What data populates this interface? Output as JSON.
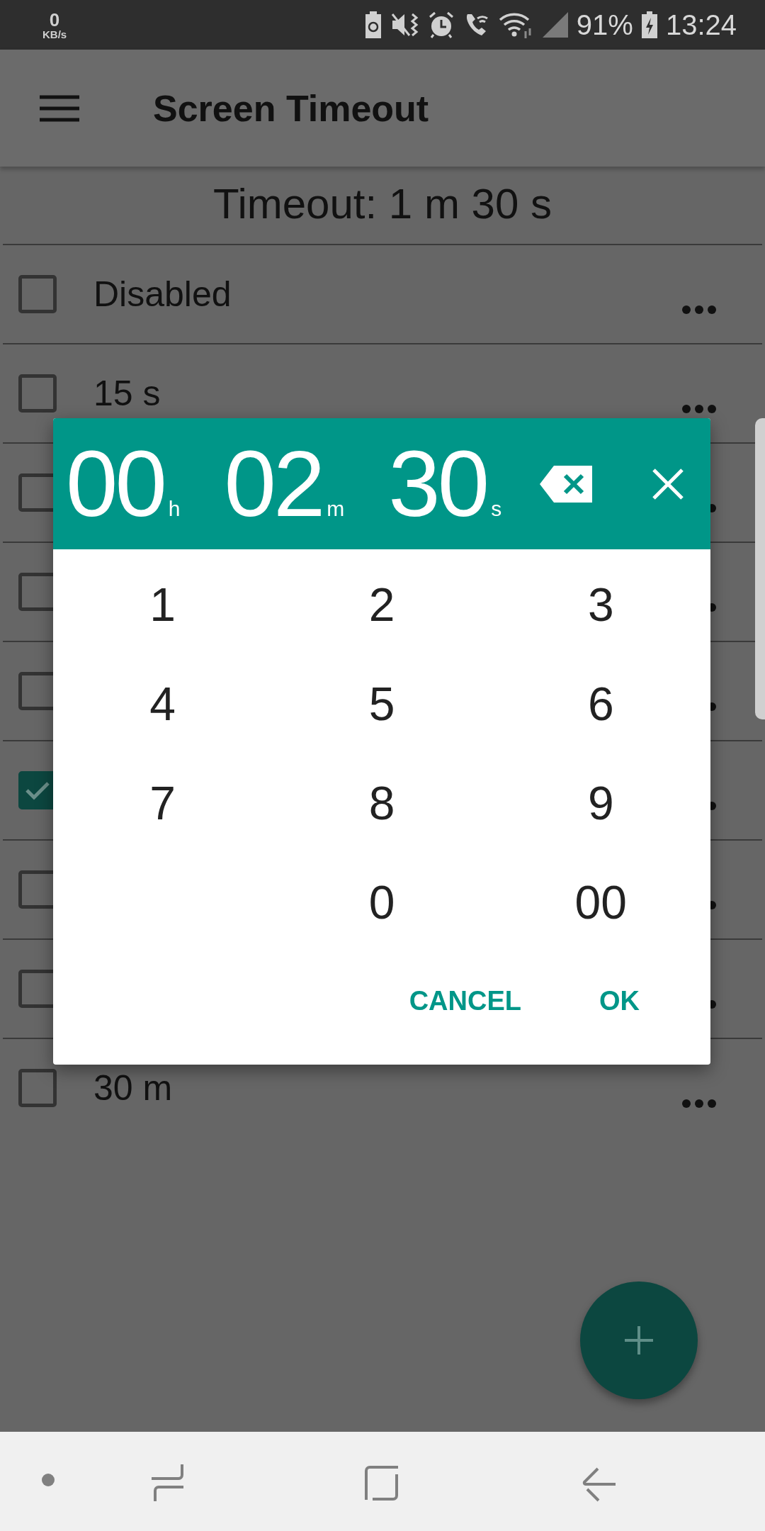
{
  "status_bar": {
    "net_speed": "0",
    "net_unit": "KB/s",
    "battery": "91%",
    "time": "13:24"
  },
  "app_bar": {
    "title": "Screen Timeout"
  },
  "timeout_label": "Timeout: 1 m 30 s",
  "options": [
    {
      "label": "Disabled",
      "checked": false
    },
    {
      "label": "15 s",
      "checked": false
    },
    {
      "checked": false
    },
    {
      "checked": false
    },
    {
      "checked": false
    },
    {
      "checked": true
    },
    {
      "checked": false
    },
    {
      "checked": false
    },
    {
      "label": "30 m",
      "checked": false
    }
  ],
  "dialog": {
    "fields": [
      {
        "value": "00",
        "unit": "h"
      },
      {
        "value": "02",
        "unit": "m"
      },
      {
        "value": "30",
        "unit": "s"
      }
    ],
    "keypad": [
      [
        "1",
        "2",
        "3"
      ],
      [
        "4",
        "5",
        "6"
      ],
      [
        "7",
        "8",
        "9"
      ],
      [
        "0",
        "00"
      ]
    ],
    "buttons": [
      "CANCEL",
      "OK"
    ]
  }
}
